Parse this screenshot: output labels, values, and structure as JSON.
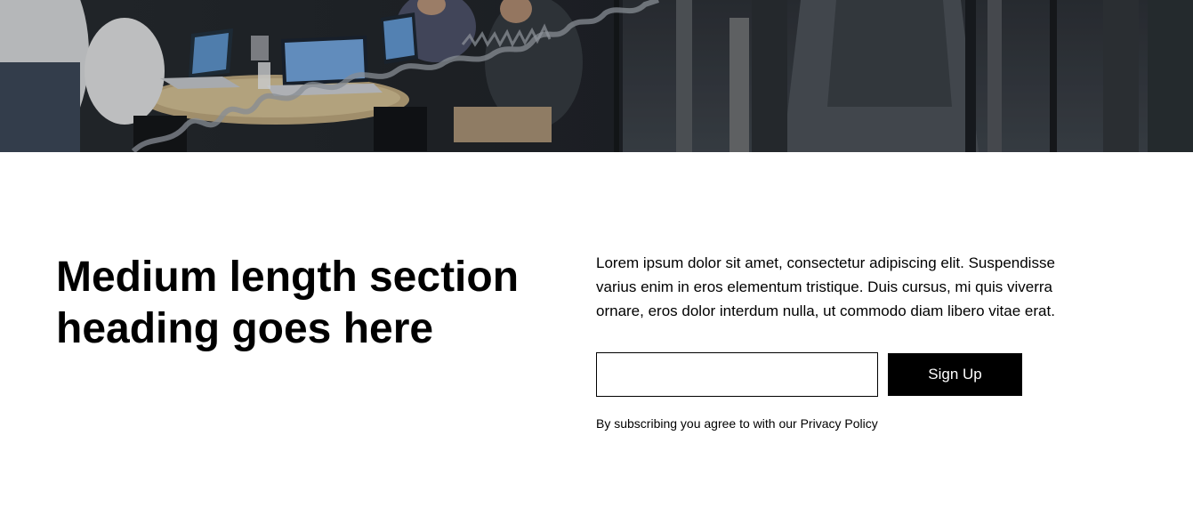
{
  "hero": {
    "image_description_icon": "office-meeting-photo"
  },
  "section": {
    "heading": "Medium length section heading goes here",
    "body": "Lorem ipsum dolor sit amet, consectetur adipiscing elit. Suspendisse varius enim in eros elementum tristique. Duis cursus, mi quis viverra ornare, eros dolor interdum nulla, ut commodo diam libero vitae erat.",
    "email_input_value": "",
    "email_input_placeholder": "",
    "signup_label": "Sign Up",
    "disclaimer_prefix": "By subscribing you agree to with our ",
    "privacy_link": "Privacy Policy"
  },
  "colors": {
    "button_bg": "#000000",
    "button_text": "#ffffff",
    "text": "#000000",
    "background": "#ffffff"
  }
}
